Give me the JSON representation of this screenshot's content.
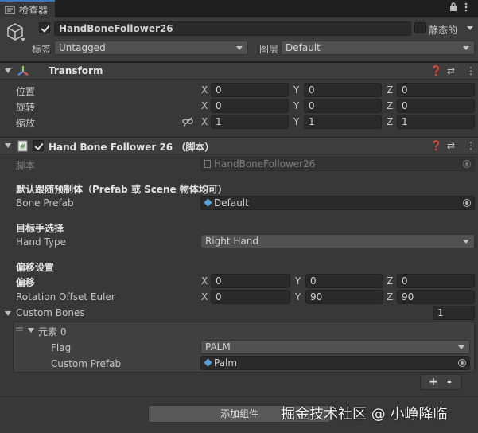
{
  "tab": {
    "title": "检查器",
    "lock_icon": "lock-icon",
    "menu_icon": "kebab-menu-icon"
  },
  "object": {
    "name": "HandBoneFollower26",
    "active": true,
    "static_label": "静态的",
    "static": false,
    "tag_label": "标签",
    "tag_value": "Untagged",
    "layer_label": "图层",
    "layer_value": "Default"
  },
  "transform": {
    "title": "Transform",
    "rows": [
      {
        "label": "位置",
        "x": "0",
        "y": "0",
        "z": "0"
      },
      {
        "label": "旋转",
        "x": "0",
        "y": "0",
        "z": "0"
      },
      {
        "label": "缩放",
        "x": "1",
        "y": "1",
        "z": "1"
      }
    ]
  },
  "axes": {
    "x": "X",
    "y": "Y",
    "z": "Z"
  },
  "component": {
    "title": "Hand Bone Follower 26 （脚本）",
    "enabled": true,
    "script_label": "脚本",
    "script_value": "HandBoneFollower26",
    "section_prefab": "默认跟随预制体（Prefab 或 Scene 物体均可）",
    "bone_prefab_label": "Bone Prefab",
    "bone_prefab_value": "Default",
    "section_hand": "目标手选择",
    "hand_type_label": "Hand Type",
    "hand_type_value": "Right Hand",
    "section_offset": "偏移设置",
    "offset_label": "偏移",
    "offset": {
      "x": "0",
      "y": "0",
      "z": "0"
    },
    "rotation_label": "Rotation Offset Euler",
    "rotation": {
      "x": "0",
      "y": "90",
      "z": "90"
    },
    "custom_bones_label": "Custom Bones",
    "custom_bones_count": "1",
    "element_label": "元素 0",
    "flag_label": "Flag",
    "flag_value": "PALM",
    "custom_prefab_label": "Custom Prefab",
    "custom_prefab_value": "Palm",
    "add_symbol": "+",
    "remove_symbol": "-"
  },
  "add_component_label": "添加组件",
  "watermark": "掘金技术社区 @ 小峥降临"
}
